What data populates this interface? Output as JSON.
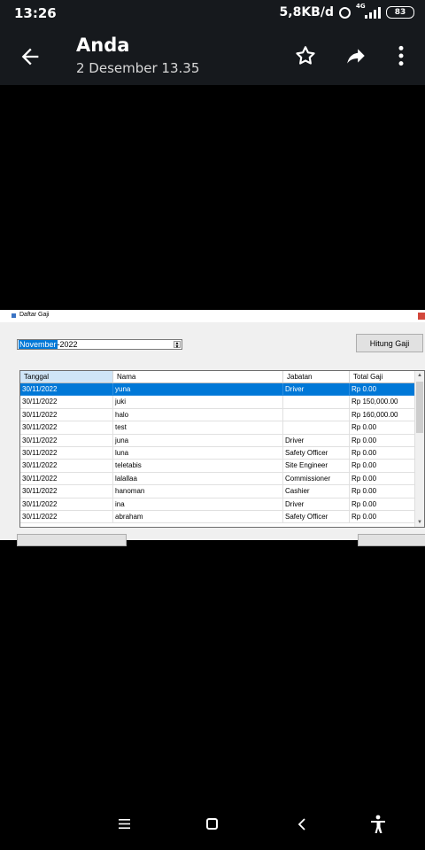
{
  "status_bar": {
    "time": "13:26",
    "network_speed": "5,8KB/d",
    "network_type": "4G",
    "battery": "83"
  },
  "app_bar": {
    "title": "Anda",
    "subtitle": "2 Desember 13.35"
  },
  "window": {
    "title": "Daftar Gaji",
    "month_picker": {
      "month": "November",
      "rest": "-2022"
    },
    "hitung_button": "Hitung Gaji",
    "grid": {
      "headers": [
        "Tanggal",
        "Nama",
        "Jabatan",
        "Total Gaji"
      ],
      "rows": [
        [
          "30/11/2022",
          "yuna",
          "Driver",
          "Rp 0.00"
        ],
        [
          "30/11/2022",
          "juki",
          "",
          "Rp 150,000.00"
        ],
        [
          "30/11/2022",
          "halo",
          "",
          "Rp 160,000.00"
        ],
        [
          "30/11/2022",
          "test",
          "",
          "Rp 0.00"
        ],
        [
          "30/11/2022",
          "juna",
          "Driver",
          "Rp 0.00"
        ],
        [
          "30/11/2022",
          "luna",
          "Safety Officer",
          "Rp 0.00"
        ],
        [
          "30/11/2022",
          "teletabis",
          "Site Engineer",
          "Rp 0.00"
        ],
        [
          "30/11/2022",
          "lalallaa",
          "Commissioner",
          "Rp 0.00"
        ],
        [
          "30/11/2022",
          "hanoman",
          "Cashier",
          "Rp 0.00"
        ],
        [
          "30/11/2022",
          "ina",
          "Driver",
          "Rp 0.00"
        ],
        [
          "30/11/2022",
          "abraham",
          "Safety Officer",
          "Rp 0.00"
        ]
      ],
      "selected_row": 0
    }
  },
  "icons": {
    "back": "back-arrow-icon",
    "star": "star-icon",
    "share": "share-icon",
    "more": "more-vert-icon",
    "nav_menu": "menu-icon",
    "nav_home": "home-icon",
    "nav_back": "nav-back-icon",
    "accessibility": "accessibility-icon"
  },
  "colors": {
    "selection": "#0078d7",
    "app_bar": "#16191d",
    "background": "#000000"
  }
}
